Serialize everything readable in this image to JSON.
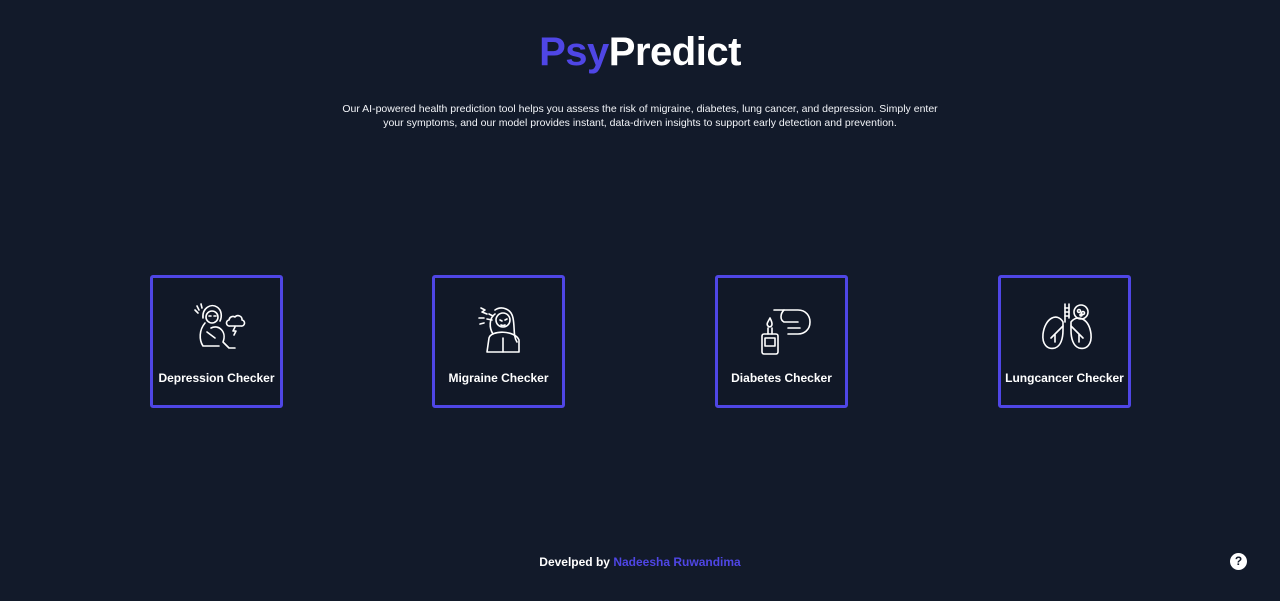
{
  "brand": {
    "title_accent": "Psy",
    "title_main": "Predict",
    "accent_color": "#4f46e5"
  },
  "intro": {
    "text": "Our AI-powered health prediction tool helps you assess the risk of migraine, diabetes, lung cancer, and depression. Simply enter your symptoms, and our model provides instant, data-driven insights to support early detection and prevention."
  },
  "cards": [
    {
      "label": "Depression Checker",
      "icon": "depressed-person-icon"
    },
    {
      "label": "Migraine Checker",
      "icon": "migraine-headache-icon"
    },
    {
      "label": "Diabetes Checker",
      "icon": "glucose-meter-icon"
    },
    {
      "label": "Lungcancer Checker",
      "icon": "lungs-icon"
    }
  ],
  "footer": {
    "prefix": "Develped by",
    "author": "Nadeesha Ruwandima"
  },
  "help": {
    "glyph": "?",
    "icon": "question-circle-icon"
  }
}
